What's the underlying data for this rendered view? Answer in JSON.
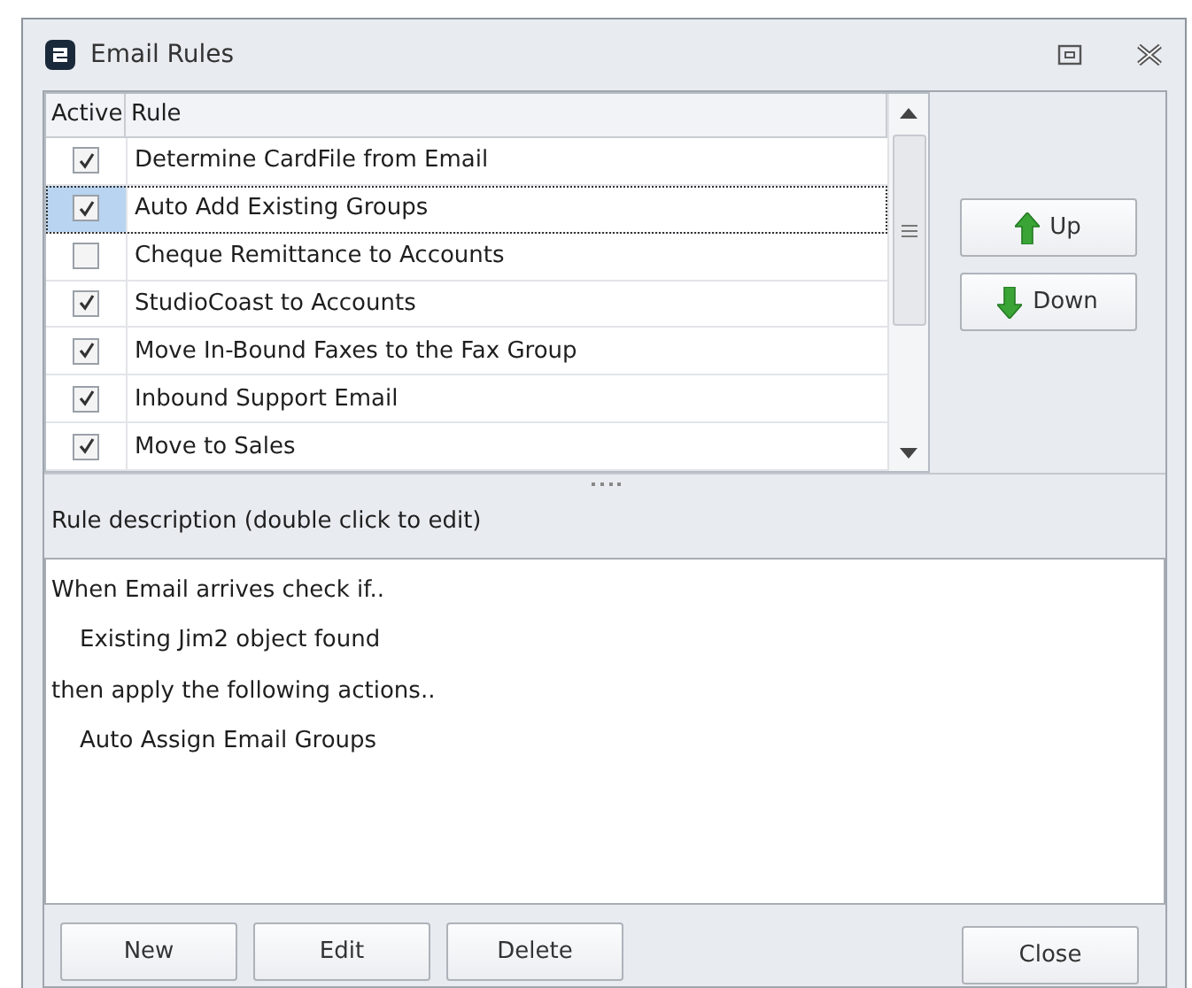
{
  "window": {
    "title": "Email Rules"
  },
  "table": {
    "columns": [
      "Active",
      "Rule"
    ],
    "rows": [
      {
        "active": true,
        "rule": "Determine CardFile from Email",
        "selected": false
      },
      {
        "active": true,
        "rule": "Auto Add Existing Groups",
        "selected": true
      },
      {
        "active": false,
        "rule": "Cheque Remittance to Accounts",
        "selected": false
      },
      {
        "active": true,
        "rule": "StudioCoast to Accounts",
        "selected": false
      },
      {
        "active": true,
        "rule": "Move In-Bound Faxes to the Fax Group",
        "selected": false
      },
      {
        "active": true,
        "rule": "Inbound Support Email",
        "selected": false
      },
      {
        "active": true,
        "rule": "Move to Sales",
        "selected": false
      }
    ]
  },
  "move_buttons": [
    {
      "kind": "up",
      "label": "Up"
    },
    {
      "kind": "down",
      "label": "Down"
    }
  ],
  "description": {
    "label": "Rule description (double click to edit)",
    "lines": [
      {
        "kind": "heading",
        "text": "When Email arrives check if.."
      },
      {
        "kind": "item",
        "text": "Existing Jim2 object found"
      },
      {
        "kind": "heading",
        "text": "then apply the following actions.."
      },
      {
        "kind": "item",
        "text": "Auto Assign Email Groups"
      }
    ]
  },
  "buttons": [
    "New",
    "Edit",
    "Delete"
  ],
  "close_button": "Close"
}
